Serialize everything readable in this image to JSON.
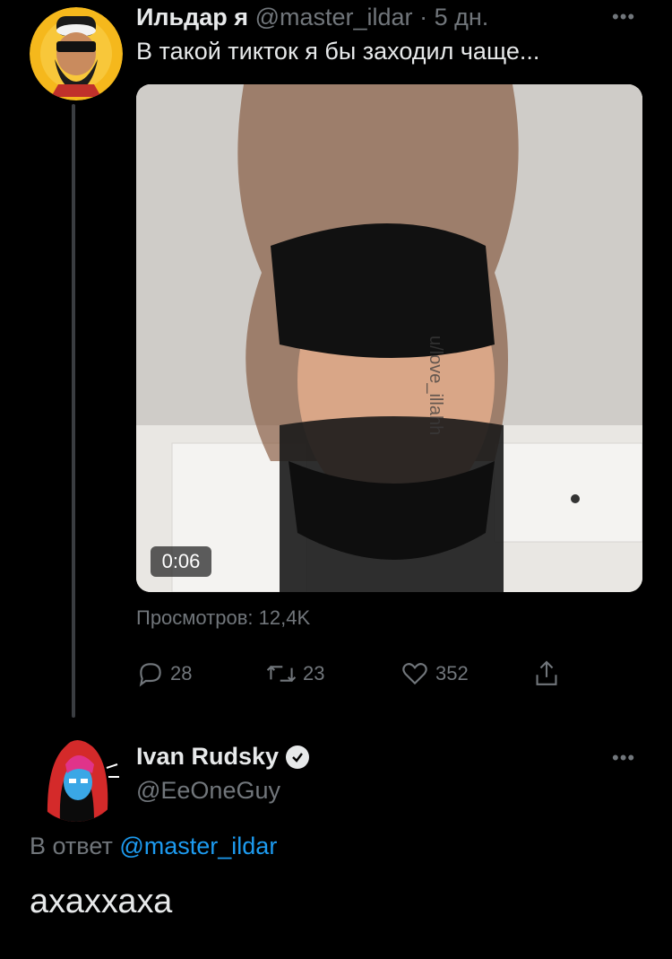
{
  "tweet": {
    "author_name": "Ильдар я",
    "author_handle": "@master_ildar",
    "separator": "·",
    "age": "5 дн.",
    "text": "В такой тикток я бы заходил чаще...",
    "video_duration": "0:06",
    "watermark": "u/love_illahh",
    "views": "Просмотров: 12,4K",
    "more": "•••",
    "actions": {
      "replies": "28",
      "retweets": "23",
      "likes": "352"
    }
  },
  "reply": {
    "author_name": "Ivan Rudsky",
    "author_handle": "@EeOneGuy",
    "reply_prefix": "В ответ",
    "reply_to": "@master_ildar",
    "text": "ахаххаха",
    "more": "•••"
  },
  "colors": {
    "background": "#000000",
    "accent": "#1d9bf0",
    "muted": "#71767b"
  }
}
